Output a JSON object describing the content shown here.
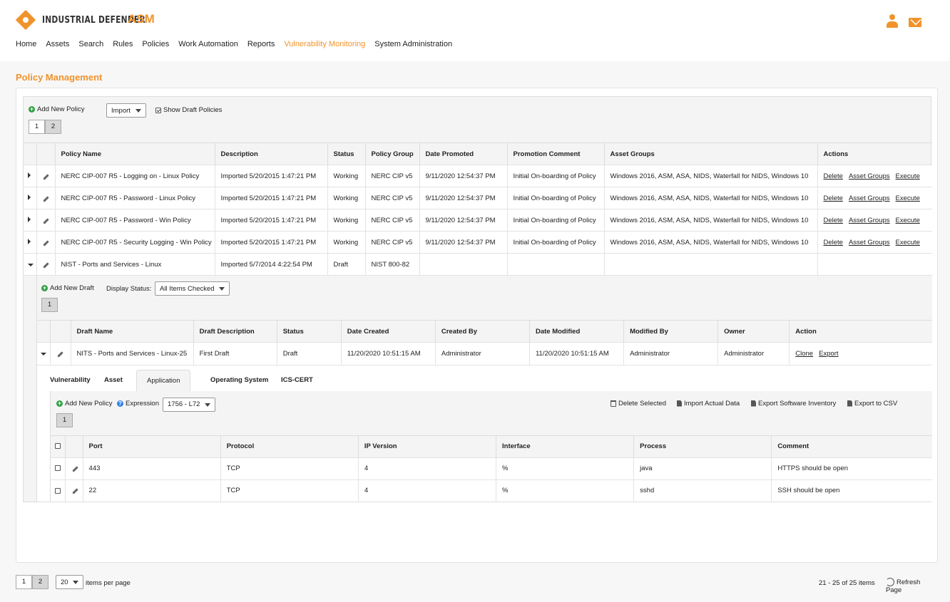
{
  "app": {
    "logo_text": "INDUSTRIAL DEFENDER",
    "logo_suffix": "ASM",
    "accent_color": "#f0932b"
  },
  "header_icons": [
    "user-icon",
    "mail-icon"
  ],
  "nav": [
    {
      "label": "Home"
    },
    {
      "label": "Assets"
    },
    {
      "label": "Search"
    },
    {
      "label": "Rules"
    },
    {
      "label": "Policies"
    },
    {
      "label": "Work Automation"
    },
    {
      "label": "Reports"
    },
    {
      "label": "Vulnerability Monitoring",
      "active": true
    },
    {
      "label": "System Administration"
    }
  ],
  "page_title": "Policy Management",
  "policy_toolbar": {
    "add_label": "Add New Policy",
    "import_label": "Import",
    "show_draft_label": "Show Draft Policies",
    "show_draft_checked": true,
    "pages": [
      "1",
      "2"
    ],
    "selected_page": "2"
  },
  "policy_columns": [
    "Policy Name",
    "Description",
    "Status",
    "Policy Group",
    "Date Promoted",
    "Promotion Comment",
    "Asset Groups",
    "Actions"
  ],
  "policies": [
    {
      "name": "NERC CIP-007 R5 - Logging on - Linux Policy",
      "description": "Imported 5/20/2015 1:47:21 PM",
      "status": "Working",
      "group": "NERC CIP v5",
      "promoted": "9/11/2020 12:54:37 PM",
      "comment": "Initial On-boarding of Policy",
      "asset_groups": "Windows 2016, ASM, ASA, NIDS, Waterfall for NIDS, Windows 10",
      "expanded": false
    },
    {
      "name": "NERC CIP-007 R5 - Password - Linux Policy",
      "description": "Imported 5/20/2015 1:47:21 PM",
      "status": "Working",
      "group": "NERC CIP v5",
      "promoted": "9/11/2020 12:54:37 PM",
      "comment": "Initial On-boarding of Policy",
      "asset_groups": "Windows 2016, ASM, ASA, NIDS, Waterfall for NIDS, Windows 10",
      "expanded": false
    },
    {
      "name": "NERC CIP-007 R5 - Password - Win Policy",
      "description": "Imported 5/20/2015 1:47:21 PM",
      "status": "Working",
      "group": "NERC CIP v5",
      "promoted": "9/11/2020 12:54:37 PM",
      "comment": "Initial On-boarding of Policy",
      "asset_groups": "Windows 2016, ASM, ASA, NIDS, Waterfall for NIDS, Windows 10",
      "expanded": false
    },
    {
      "name": "NERC CIP-007 R5 - Security Logging - Win Policy",
      "description": "Imported 5/20/2015 1:47:21 PM",
      "status": "Working",
      "group": "NERC CIP v5",
      "promoted": "9/11/2020 12:54:37 PM",
      "comment": "Initial On-boarding of Policy",
      "asset_groups": "Windows 2016, ASM, ASA, NIDS, Waterfall for NIDS, Windows 10",
      "expanded": false
    },
    {
      "name": "NIST - Ports and Services - Linux",
      "description": "Imported 5/7/2014 4:22:54 PM",
      "status": "Draft",
      "group": "NIST 800-82",
      "promoted": "",
      "comment": "",
      "asset_groups": "",
      "expanded": true
    }
  ],
  "policy_actions": [
    "Delete",
    "Asset Groups",
    "Execute"
  ],
  "draft_toolbar": {
    "add_label": "Add New Draft",
    "display_status_label": "Display Status:",
    "display_status_value": "All Items Checked",
    "pages": [
      "1"
    ]
  },
  "draft_columns": [
    "Draft Name",
    "Draft Description",
    "Status",
    "Date Created",
    "Created By",
    "Date Modified",
    "Modified By",
    "Owner",
    "Action"
  ],
  "drafts": [
    {
      "name": "NITS - Ports and Services - Linux-25",
      "description": "First Draft",
      "status": "Draft",
      "created": "11/20/2020 10:51:15 AM",
      "created_by": "Administrator",
      "modified": "11/20/2020 10:51:15 AM",
      "modified_by": "Administrator",
      "owner": "Administrator"
    }
  ],
  "draft_actions": [
    "Clone",
    "Export"
  ],
  "tabs": [
    {
      "label": "Vulnerability"
    },
    {
      "label": "Asset"
    },
    {
      "label": "Application",
      "active": true
    },
    {
      "label": "Operating System"
    },
    {
      "label": "ICS-CERT"
    }
  ],
  "app_toolbar": {
    "add_label": "Add New Policy",
    "expression_label": "Expression",
    "expression_value": "1756 - L72",
    "delete_label": "Delete Selected",
    "import_label": "Import Actual Data",
    "export_inventory_label": "Export Software Inventory",
    "export_csv_label": "Export to CSV",
    "pages": [
      "1"
    ]
  },
  "app_columns": [
    "Port",
    "Protocol",
    "IP Version",
    "Interface",
    "Process",
    "Comment"
  ],
  "app_rows": [
    {
      "port": "443",
      "protocol": "TCP",
      "ip_version": "4",
      "interface": "%",
      "process": "java",
      "comment": "HTTPS should be open"
    },
    {
      "port": "22",
      "protocol": "TCP",
      "ip_version": "4",
      "interface": "%",
      "process": "sshd",
      "comment": "SSH should be open"
    }
  ],
  "footer": {
    "pages": [
      "1",
      "2"
    ],
    "selected_page": "2",
    "page_size": "20",
    "per_page_label": "items per page",
    "range_label": "21 - 25 of 25 items",
    "refresh_label": "Refresh Page"
  }
}
